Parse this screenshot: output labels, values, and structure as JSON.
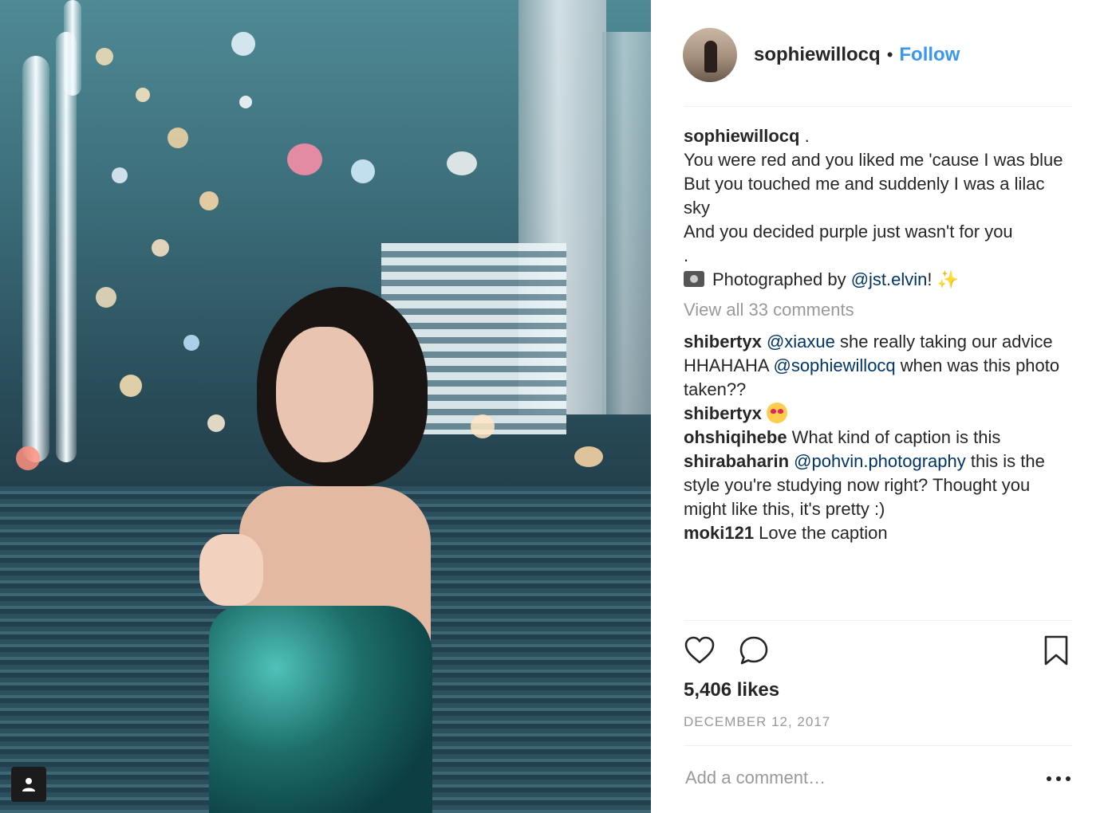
{
  "post": {
    "username": "sophiewillocq",
    "separator": "•",
    "follow_label": "Follow"
  },
  "caption": {
    "username": "sophiewillocq",
    "line1": " .",
    "line2": "You were red and you liked me 'cause I was blue",
    "line3": "But you touched me and suddenly I was a lilac sky",
    "line4": "And you decided purple just wasn't for you",
    "line5": ".",
    "credit_prefix": "Photographed by ",
    "credit_mention": "@jst.elvin",
    "credit_suffix": "! ",
    "sparkle": "✨"
  },
  "view_all_label": "View all 33 comments",
  "comments": [
    {
      "user": "shibertyx",
      "m1": "@xiaxue",
      "t1": " she really taking our advice HHAHAHA ",
      "m2": "@sophiewillocq",
      "t2": " when was this photo taken??"
    },
    {
      "user": "shibertyx",
      "icon": "heart-eyes-emoji-icon"
    },
    {
      "user": "ohshiqihebe",
      "text": " What kind of caption is this"
    },
    {
      "user": "shirabaharin",
      "m1": "@pohvin.photography",
      "t1": " this is the style you're studying now right? Thought you might like this, it's pretty :)"
    },
    {
      "user": "moki121",
      "text": " Love the caption"
    }
  ],
  "likes_label": "5,406 likes",
  "date_label": "DECEMBER 12, 2017",
  "add_comment_placeholder": "Add a comment…",
  "icons": {
    "like": "heart-outline-icon",
    "comment": "speech-bubble-icon",
    "save": "bookmark-icon",
    "more": "more-horizontal-icon",
    "photo_tag": "person-tag-icon",
    "camera": "camera-emoji-icon"
  },
  "colors": {
    "link": "#3897f0",
    "mention": "#003569",
    "muted": "#999999",
    "text": "#262626"
  }
}
